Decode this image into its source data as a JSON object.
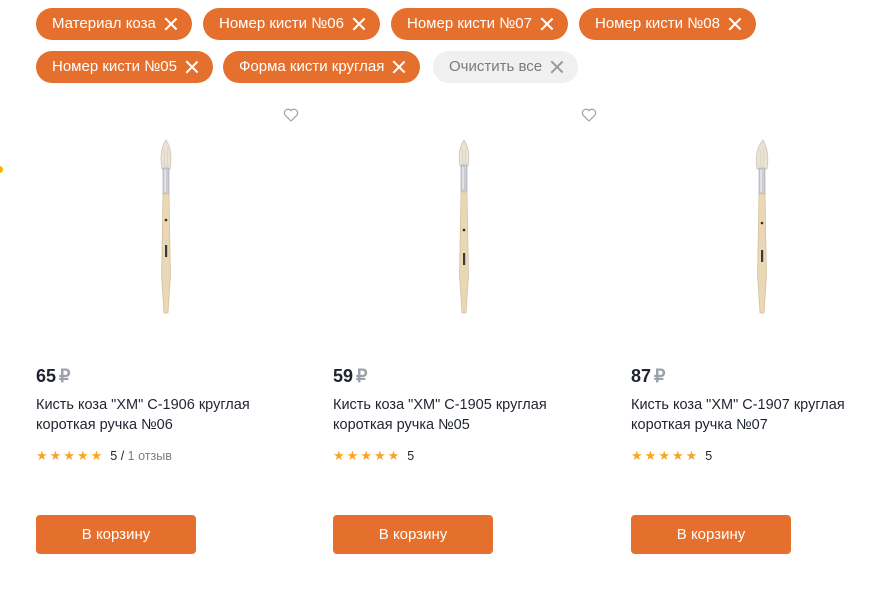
{
  "filters": {
    "chips": [
      {
        "label": "Материал коза"
      },
      {
        "label": "Номер кисти №06"
      },
      {
        "label": "Номер кисти №07"
      },
      {
        "label": "Номер кисти №08"
      },
      {
        "label": "Номер кисти №05"
      },
      {
        "label": "Форма кисти круглая"
      }
    ],
    "clear_label": "Очистить все"
  },
  "products": [
    {
      "price": "65",
      "currency": "₽",
      "title": "Кисть коза \"ХМ\" С-1906 круглая короткая ручка №06",
      "rating_value": "5",
      "rating_sep": " / ",
      "reviews": "1 отзыв",
      "cart_label": "В корзину"
    },
    {
      "price": "59",
      "currency": "₽",
      "title": "Кисть коза \"ХМ\" С-1905 круглая короткая ручка №05",
      "rating_value": "5",
      "cart_label": "В корзину"
    },
    {
      "price": "87",
      "currency": "₽",
      "title": "Кисть коза \"ХМ\" С-1907 круглая короткая ручка №07",
      "rating_value": "5",
      "cart_label": "В корзину"
    }
  ],
  "colors": {
    "accent": "#e5702e",
    "star": "#f6a623",
    "price_text": "#1f2430",
    "chip_clear_bg": "#f0f0f0"
  },
  "icons": [
    "close-icon",
    "heart-icon",
    "star-icon",
    "ruble-icon"
  ]
}
